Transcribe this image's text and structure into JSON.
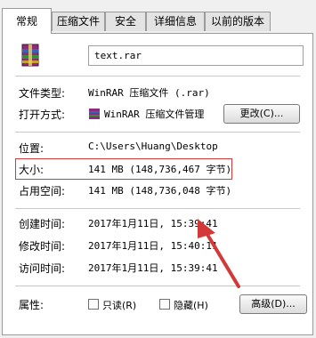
{
  "tabs": [
    "常规",
    "压缩文件",
    "安全",
    "详细信息",
    "以前的版本"
  ],
  "file": {
    "name": "text.rar",
    "icon": "winrar-archive-icon"
  },
  "props": {
    "type_label": "文件类型:",
    "type_value": "WinRAR 压缩文件 (.rar)",
    "open_label": "打开方式:",
    "open_value": "WinRAR 压缩文件管理",
    "change_button": "更改(C)...",
    "location_label": "位置:",
    "location_value": "C:\\Users\\Huang\\Desktop",
    "size_label": "大小:",
    "size_value": "141 MB (148,736,467 字节)",
    "disk_label": "占用空间:",
    "disk_value": "141 MB (148,736,048 字节)",
    "created_label": "创建时间:",
    "created_value": "2017年1月11日, 15:39:41",
    "modified_label": "修改时间:",
    "modified_value": "2017年1月11日, 15:40:11",
    "accessed_label": "访问时间:",
    "accessed_value": "2017年1月11日, 15:39:41",
    "attr_label": "属性:",
    "readonly": "只读(R)",
    "hidden": "隐藏(H)",
    "advanced_button": "高级(D)..."
  },
  "colors": {
    "highlight": "#d23a3a"
  }
}
